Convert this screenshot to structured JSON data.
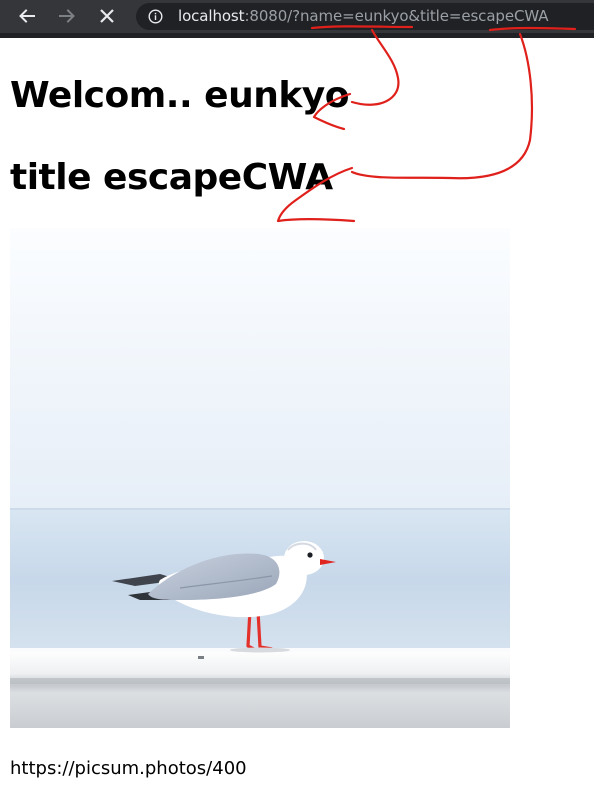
{
  "browser": {
    "url_host": "localhost",
    "url_rest": ":8080/?name=eunkyo&title=escapeCWA",
    "icons": {
      "back": "arrow-left-icon",
      "forward": "arrow-right-icon",
      "stop": "close-icon",
      "site_info": "info-icon"
    }
  },
  "page": {
    "welcome_text": "Welcom.. eunkyo",
    "title_text": "title escapeCWA",
    "image_source": "https://picsum.photos/400"
  },
  "colors": {
    "annotation": "#e0201b",
    "toolbar": "#35363a",
    "omnibox": "#202124"
  }
}
